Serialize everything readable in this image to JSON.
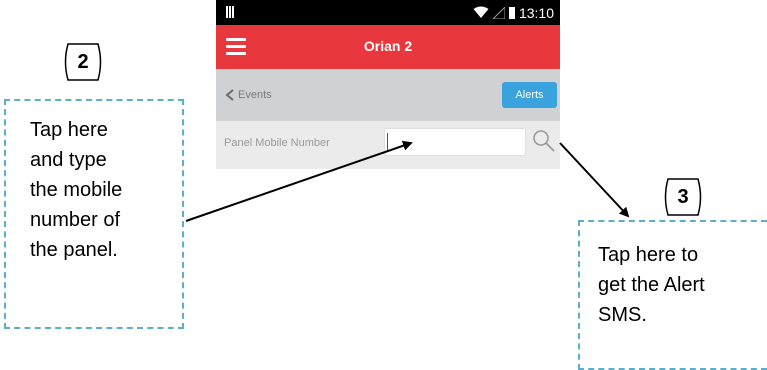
{
  "status_bar": {
    "time": "13:10",
    "icons": [
      "sim-icon",
      "wifi-icon",
      "signal-icon",
      "battery-icon"
    ]
  },
  "app_bar": {
    "title": "Orian 2",
    "menu_icon": "hamburger-menu-icon",
    "color": "#e8383d"
  },
  "toolbar": {
    "back_label": "Events",
    "back_icon": "chevron-left-icon",
    "alerts_label": "Alerts",
    "alerts_color": "#3aa3de"
  },
  "form": {
    "field_label": "Panel Mobile Number",
    "field_value": "",
    "search_icon": "search-icon"
  },
  "callouts": {
    "step2": {
      "number": "2",
      "lines": [
        "Tap here",
        "and type",
        "the mobile",
        "number of",
        "the panel."
      ]
    },
    "step3": {
      "number": "3",
      "lines": [
        "Tap here to",
        "get the Alert",
        "SMS."
      ]
    },
    "border_color": "#5bb0c8"
  }
}
